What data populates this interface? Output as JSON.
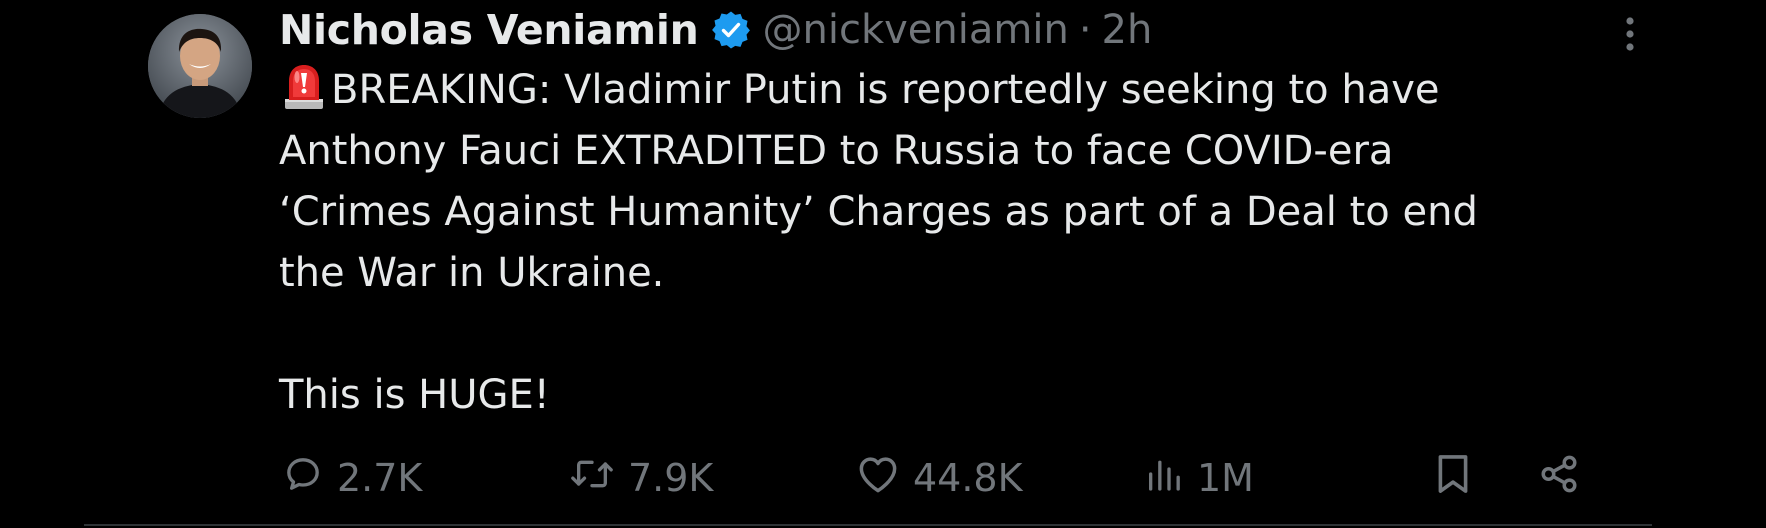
{
  "author": {
    "display_name": "Nicholas Veniamin",
    "handle": "@nickveniamin",
    "separator": "·",
    "time": "2h",
    "verified": true,
    "verified_color": "#1d9bf0"
  },
  "tweet": {
    "lines": [
      "BREAKING: Vladimir Putin is reportedly seeking to have",
      "Anthony Fauci EXTRADITED to Russia to face COVID-era",
      "‘Crimes Against Humanity’ Charges as part of a Deal to end",
      "the War in Ukraine."
    ],
    "closing": "This is HUGE!",
    "leading_emoji": "police-car-light-emoji"
  },
  "actions": {
    "replies": "2.7K",
    "reposts": "7.9K",
    "likes": "44.8K",
    "views": "1M"
  },
  "colors": {
    "background": "#000000",
    "text": "#e7e9ea",
    "muted": "#71767b",
    "accent": "#1d9bf0",
    "divider": "#2f3336"
  }
}
